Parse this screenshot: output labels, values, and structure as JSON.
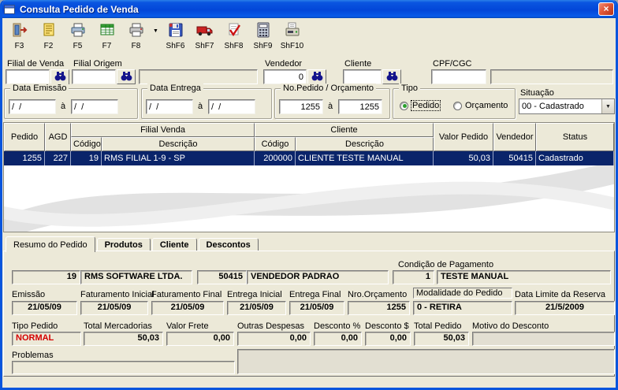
{
  "window": {
    "title": "Consulta Pedido de Venda",
    "close_glyph": "×"
  },
  "toolbar": {
    "dropdown_glyph": "▼",
    "buttons": [
      {
        "key": "F3",
        "icon": "exit-door-icon"
      },
      {
        "key": "F2",
        "icon": "document-print-icon"
      },
      {
        "key": "F5",
        "icon": "printer-icon"
      },
      {
        "key": "F7",
        "icon": "grid-report-icon"
      },
      {
        "key": "F8",
        "icon": "printer-alt-icon"
      },
      {
        "key": "ShF6",
        "icon": "save-icon"
      },
      {
        "key": "ShF7",
        "icon": "truck-icon"
      },
      {
        "key": "ShF8",
        "icon": "check-document-icon"
      },
      {
        "key": "ShF9",
        "icon": "calculator-icon"
      },
      {
        "key": "ShF10",
        "icon": "fax-icon"
      }
    ]
  },
  "filters": {
    "filial_venda_label": "Filial de Venda",
    "filial_venda_value": "",
    "filial_origem_label": "Filial Origem",
    "filial_origem_value": "",
    "filial_origem_desc": "",
    "vendedor_label": "Vendedor",
    "vendedor_value": "0",
    "cliente_label": "Cliente",
    "cliente_value": "",
    "cpf_label": "CPF/CGC",
    "cpf_value": "",
    "cpf_desc": "",
    "data_emissao": {
      "label": "Data Emissão",
      "from": "/  /",
      "sep": "à",
      "to": "/  /"
    },
    "data_entrega": {
      "label": "Data Entrega",
      "from": "/  /",
      "sep": "à",
      "to": "/  /"
    },
    "pedido_range": {
      "label": "No.Pedido / Orçamento",
      "from": "1255",
      "sep": "à",
      "to": "1255"
    },
    "tipo": {
      "label": "Tipo",
      "option1": "Pedido",
      "option2": "Orçamento"
    },
    "situacao_label": "Situação",
    "situacao_value": "00 - Cadastrado"
  },
  "grid": {
    "headers": {
      "pedido": "Pedido",
      "agd": "AGD",
      "filial_venda": "Filial Venda",
      "cliente": "Cliente",
      "codigo": "Código",
      "descricao": "Descrição",
      "valor_pedido": "Valor Pedido",
      "vendedor": "Vendedor",
      "status": "Status"
    },
    "rows": [
      {
        "pedido": "1255",
        "agd": "227",
        "fv_codigo": "19",
        "fv_descricao": "RMS FILIAL 1-9 - SP",
        "cl_codigo": "200000",
        "cl_descricao": "CLIENTE TESTE MANUAL",
        "valor": "50,03",
        "vendedor": "50415",
        "status": "Cadastrado"
      }
    ]
  },
  "tabs": [
    {
      "label": "Resumo do Pedido",
      "active": true
    },
    {
      "label": "Produtos",
      "active": false
    },
    {
      "label": "Cliente",
      "active": false
    },
    {
      "label": "Descontos",
      "active": false
    }
  ],
  "resumo": {
    "condicao_label": "Condição de Pagamento",
    "filial_codigo": "19",
    "filial_nome": "RMS SOFTWARE LTDA.",
    "vendedor_codigo": "50415",
    "vendedor_nome": "VENDEDOR PADRAO",
    "condicao_codigo": "1",
    "condicao_nome": "TESTE MANUAL",
    "emissao_label": "Emissão",
    "emissao": "21/05/09",
    "fat_inicial_label": "Faturamento Inicial",
    "fat_inicial": "21/05/09",
    "fat_final_label": "Faturamento Final",
    "fat_final": "21/05/09",
    "ent_inicial_label": "Entrega Inicial",
    "ent_inicial": "21/05/09",
    "ent_final_label": "Entrega Final",
    "ent_final": "21/05/09",
    "nro_orc_label": "Nro.Orçamento",
    "nro_orc": "1255",
    "modalidade_label": "Modalidade do Pedido",
    "modalidade": "0 - RETIRA",
    "data_limite_label": "Data Limite da Reserva",
    "data_limite": "21/5/2009",
    "tipo_pedido_label": "Tipo Pedido",
    "tipo_pedido": "NORMAL",
    "total_merc_label": "Total Mercadorias",
    "total_merc": "50,03",
    "frete_label": "Valor Frete",
    "frete": "0,00",
    "despesas_label": "Outras Despesas",
    "despesas": "0,00",
    "desc_pct_label": "Desconto %",
    "desc_pct": "0,00",
    "desc_val_label": "Desconto $",
    "desc_val": "0,00",
    "total_pedido_label": "Total Pedido",
    "total_pedido": "50,03",
    "motivo_label": "Motivo do Desconto",
    "motivo": "",
    "problemas_label": "Problemas",
    "problemas": ""
  },
  "colors": {
    "titlebar_blue": "#0A55E0",
    "selection_navy": "#0A246A",
    "window_bg": "#ECE9D8",
    "alert_red": "#D40000"
  }
}
